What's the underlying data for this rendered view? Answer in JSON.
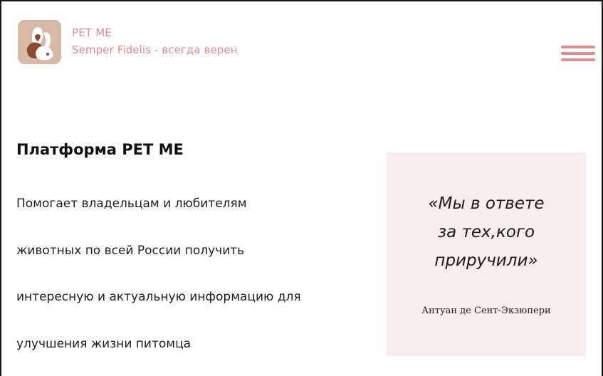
{
  "header": {
    "logo_icon": "pet-me-logo-icon",
    "brand_name": "PET ME",
    "tagline": "Semper Fidelis - всегда верен",
    "menu_icon": "hamburger-menu-icon"
  },
  "main": {
    "heading": "Платформа PET ME",
    "description_lines": [
      "Помогает владельцам и любителям",
      "животных по всей России получить",
      "интересную и актуальную информацию для",
      "улучшения жизни питомца"
    ]
  },
  "quote": {
    "lines": [
      "«Мы в ответе",
      "за тех,кого",
      "приручили»"
    ],
    "author": "Антуан де Сент-Экзюпери"
  },
  "colors": {
    "accent": "#e48b8b",
    "logo_background": "#d7b9a6",
    "quote_background": "#f7eded",
    "text": "#111111"
  }
}
